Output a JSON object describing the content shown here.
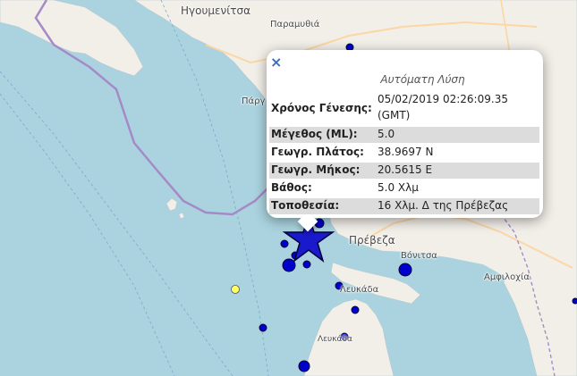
{
  "map": {
    "places": [
      {
        "id": "igoumenitsa",
        "label": "Ηγουμενίτσα"
      },
      {
        "id": "paramythia",
        "label": "Παραμυθιά"
      },
      {
        "id": "parga",
        "label": "Πάργ"
      },
      {
        "id": "preveza",
        "label": "Πρέβεζα"
      },
      {
        "id": "vonitsa",
        "label": "Βόνιτσα"
      },
      {
        "id": "amfilochia",
        "label": "Αμφιλοχία"
      },
      {
        "id": "lefkada",
        "label": "Λευκάδα"
      },
      {
        "id": "lefkada2",
        "label": "Λευκάδα"
      }
    ],
    "colors": {
      "sea": "#aad3df",
      "land": "#f2efe9",
      "marker_fill": "#0000cc",
      "marker_stroke": "#00003a",
      "star_fill": "#1a1acd",
      "yellow_marker": "#ffff66",
      "boundary": "#a58ac8"
    }
  },
  "popup": {
    "close_label": "×",
    "title": "Αυτόματη Λύση",
    "rows": [
      {
        "label": "Χρόνος Γένεσης:",
        "value": "05/02/2019 02:26:09.35",
        "value2": "(GMT)"
      },
      {
        "label": "Μέγεθος (ML):",
        "value": "5.0"
      },
      {
        "label": "Γεωγρ. Πλάτος:",
        "value": "38.9697 N"
      },
      {
        "label": "Γεωγρ. Μήκος:",
        "value": "20.5615 E"
      },
      {
        "label": "Βάθος:",
        "value": "5.0 Χλμ"
      },
      {
        "label": "Τοποθεσία:",
        "value": "16 Χλμ. Δ της Πρέβεζας"
      }
    ]
  }
}
